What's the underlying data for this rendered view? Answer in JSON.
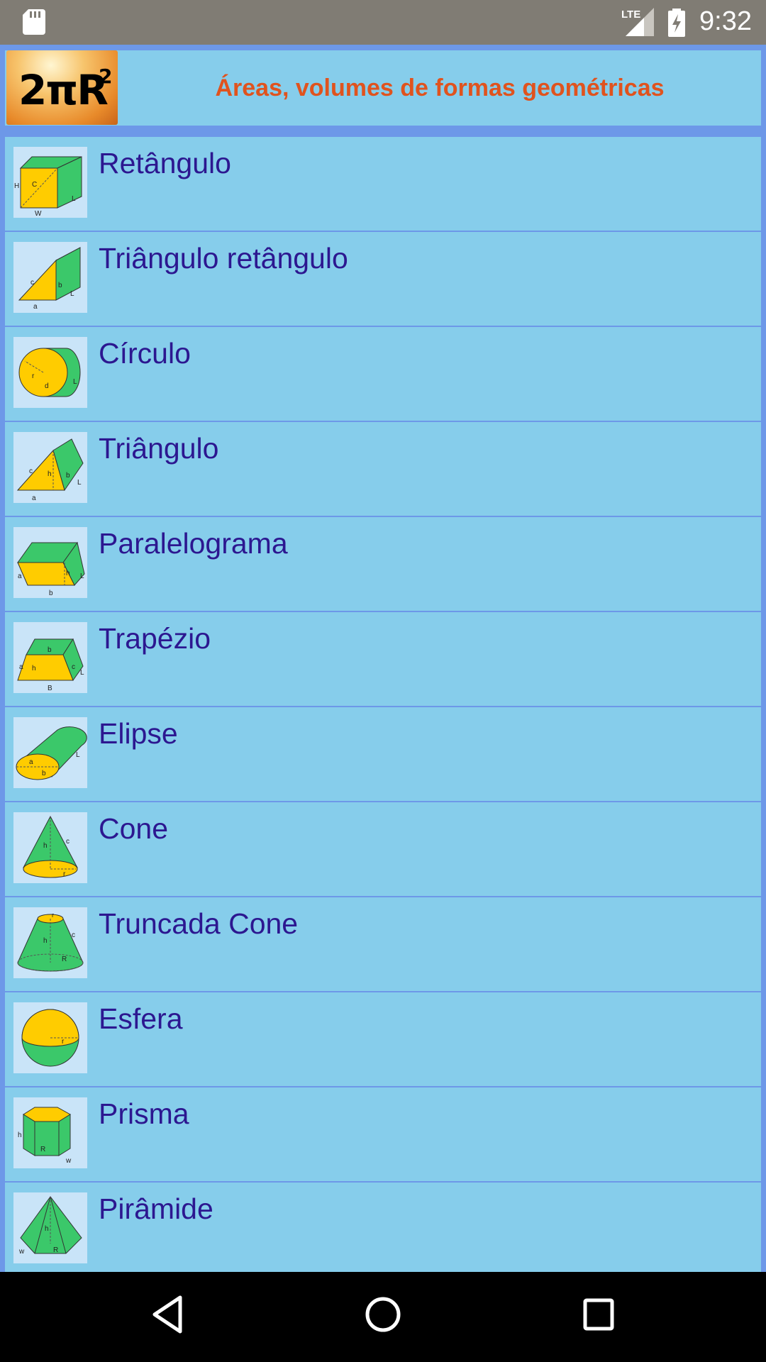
{
  "status_bar": {
    "time": "9:32",
    "network": "LTE",
    "icons": [
      "sd-card-icon",
      "lte-signal-icon",
      "battery-charging-icon"
    ]
  },
  "header": {
    "logo_text": "2πR",
    "logo_superscript": "2",
    "title": "Áreas, volumes de formas geométricas"
  },
  "colors": {
    "title": "#e0531e",
    "item_text": "#2c1790",
    "item_background": "#86cdeb",
    "divider": "#6d98e8",
    "shape_green": "#3bc86a",
    "shape_yellow": "#ffcc00"
  },
  "items": [
    {
      "label": "Retângulo",
      "icon": "rectangle-prism-icon"
    },
    {
      "label": "Triângulo retângulo",
      "icon": "right-triangle-prism-icon"
    },
    {
      "label": "Círculo",
      "icon": "cylinder-icon"
    },
    {
      "label": "Triângulo",
      "icon": "triangle-prism-icon"
    },
    {
      "label": "Paralelograma",
      "icon": "parallelogram-prism-icon"
    },
    {
      "label": "Trapézio",
      "icon": "trapezoid-prism-icon"
    },
    {
      "label": "Elipse",
      "icon": "elliptic-cylinder-icon"
    },
    {
      "label": "Cone",
      "icon": "cone-icon"
    },
    {
      "label": "Truncada Cone",
      "icon": "truncated-cone-icon"
    },
    {
      "label": "Esfera",
      "icon": "sphere-icon"
    },
    {
      "label": "Prisma",
      "icon": "hexagonal-prism-icon"
    },
    {
      "label": "Pirâmide",
      "icon": "pyramid-icon"
    }
  ],
  "nav_bar": {
    "buttons": [
      "back-icon",
      "home-icon",
      "recents-icon"
    ]
  }
}
